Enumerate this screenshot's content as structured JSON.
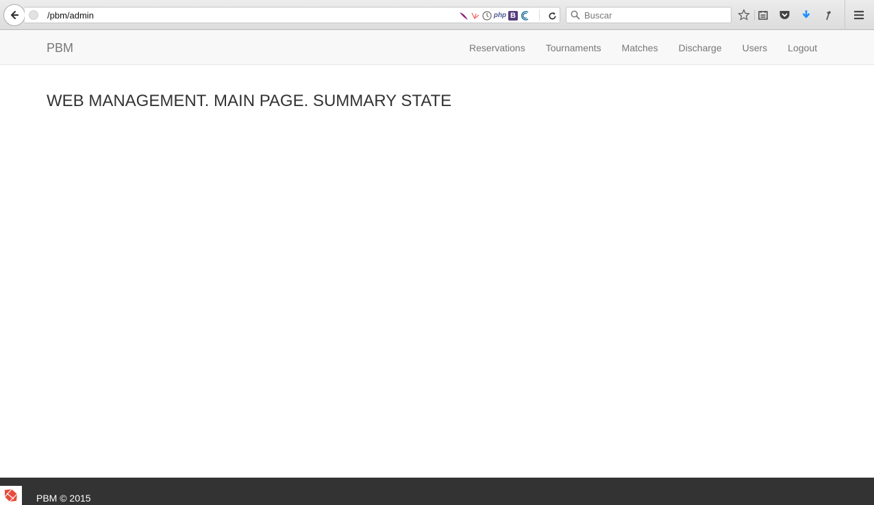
{
  "browser": {
    "url": "/pbm/admin",
    "search_placeholder": "Buscar",
    "extension_icons": [
      "feather-icon",
      "laravel-icon",
      "clock-icon",
      "php-icon",
      "bootstrap-icon",
      "wordpress-icon"
    ],
    "php_label": "php",
    "bootstrap_label": "B",
    "toolbar_icons": [
      "bookmark-star-icon",
      "reading-list-icon",
      "pocket-icon",
      "download-icon",
      "hammer-icon",
      "hamburger-menu-icon"
    ],
    "download_color": "#1e90ff"
  },
  "navbar": {
    "brand": "PBM",
    "links": [
      "Reservations",
      "Tournaments",
      "Matches",
      "Discharge",
      "Users",
      "Logout"
    ]
  },
  "main": {
    "title": "WEB MANAGEMENT. MAIN PAGE. SUMMARY STATE"
  },
  "footer": {
    "text": "PBM © 2015",
    "logo_icon": "laravel-logo-icon",
    "background": "#333333",
    "logo_color": "#e74c3c"
  }
}
